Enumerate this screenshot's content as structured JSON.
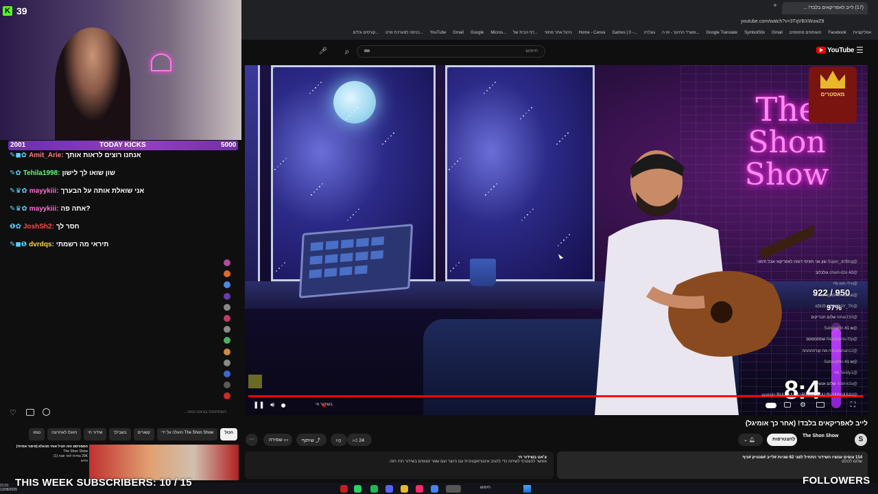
{
  "browser": {
    "tab_title": "(17) לייב לאפריקאים בלבד! ...",
    "url": "youtube.com/watch?v=3TqVBXWuwZ8",
    "bookmarks": [
      "אפליקציות",
      "Facebook",
      "השותפים מתמסים",
      "Gmail",
      "SymbolStix",
      "Google Translate",
      "משרד החינוך - זוז ה...",
      "גוגלרה",
      "Games | 0 -...",
      "Home - Canva",
      "ניהול אתר מחוזי",
      "דף הבית של...",
      "Micros...",
      "Google",
      "Gmail",
      "YouTube",
      "כניסה למערכת פרט...",
      "קורסים וכלים..."
    ]
  },
  "youtube": {
    "search_placeholder": "חיפוש",
    "logo_text": "YouTube",
    "video_title": "לייב לאפריקאים בלבד! (אחר כך אומיגל)",
    "channel_name": "The Shon Show",
    "subscribe_label": "להצטרפות",
    "like_count": "24",
    "share_label": "שיתוף",
    "save_label": "שמירה",
    "live_label": "בשידור חי",
    "description_meta": "114 צופים עכשיו  השידור התחיל לפני 62 שניות  #לייב #פנטיק #כיף",
    "description_text": "שלום לכולם",
    "chat_summary": "צ'אט בשידור חי",
    "chat_summary_sub": "אפשר להצטרף לשיחה כדי להגיב אינטראקטיבית עם היוצר ועם שאר הצופים בשידור החי הזה."
  },
  "video_overlay": {
    "neon_line1": "The",
    "neon_line2": "Shon Show",
    "badge_text": "מאסטרים",
    "timer": "8:4",
    "goal_text": "922 / 950",
    "goal_percent_label": "97%",
    "goal_fraction": 0.97
  },
  "stream_overlay": {
    "kick_count": "39",
    "kicks_min": "2001",
    "kicks_label": "TODAY KICKS",
    "kicks_max": "5000",
    "subs_text": "THIS WEEK SUBSCRIBERS: 10 / 15",
    "followers_text": "FOLLOWERS"
  },
  "kick_chat": [
    {
      "user": "Amit_Arie:",
      "text": "אנחנו רוצים לראות אותך",
      "color": "#ff7b7b",
      "badges": "✎◼✿"
    },
    {
      "user": "Tehila1998:",
      "text": "שון שואו לך לישון",
      "color": "#5cff7a",
      "badges": "✎✿"
    },
    {
      "user": "mayykiii:",
      "text": "אני שואלת אותה על הבערך",
      "color": "#ff6bd6",
      "badges": "✎♛✿"
    },
    {
      "user": "mayykiii:",
      "text": "אתה פה?",
      "color": "#ff6bd6",
      "badges": "✎♛✿"
    },
    {
      "user": "JoshSh2:",
      "text": "חסר לך",
      "color": "#ff4a4a",
      "badges": "❶✿"
    },
    {
      "user": "dvrdqs:",
      "text": "תיראי מה רשמתי",
      "color": "#ffd84a",
      "badges": "✎◼❶"
    }
  ],
  "yt_chat": [
    {
      "user": "@Super_drifting",
      "text": "שון אני תפיסי דומה לאפריקאי אבל תימני",
      "avatar": "#b04a9a"
    },
    {
      "user": "@charil-d2e",
      "text": "#2 גולבלוב",
      "avatar": "#e06a2a"
    },
    {
      "user": "@ווילי-תאו",
      "text": "היי",
      "avatar": "#4a8ae0"
    },
    {
      "user": "@ВалерийПенкасов",
      "text": "היי",
      "avatar": "#6a3ab0"
    },
    {
      "user": "@ILAY_TK",
      "text": "שלום לכולם",
      "avatar": "#888888"
    },
    {
      "user": "@tohar150",
      "text": "שלום חבריקים",
      "avatar": "#c03a6a"
    },
    {
      "user": "@Sahargitlin",
      "text": "#1 w",
      "avatar": "#8a8a8a"
    },
    {
      "user": "@NextGame-f3p",
      "text": "שסססססם",
      "avatar": "#4ab06a"
    },
    {
      "user": "@mikadahan12",
      "text": "מה קורההההה",
      "avatar": "#d08a3a"
    },
    {
      "user": "@Sahargitlin",
      "text": "#1 w",
      "avatar": "#8a8a8a"
    },
    {
      "user": "@Tendy1",
      "text": "היי",
      "avatar": "#3a6ad0"
    },
    {
      "user": "@Adel-k3u",
      "text": "שלום אנשים",
      "avatar": "#5a5a5a"
    },
    {
      "user": "@ayalajin",
      "text": "RUUUUUUU RUUUUUUU RUUUUUUUU",
      "avatar": "#d02a2a"
    }
  ],
  "chat_input_placeholder": "השתתפות בצ'אט כמוני...",
  "chips": [
    "הכול",
    "הועלה על ידי The Shon Show",
    "קשורים",
    "בשבילך",
    "שידור חי",
    "הועלו לאחרונה",
    "נצפו"
  ],
  "recommended": {
    "title": "המפורסם הזה הציל אותי מהגלא (סיפור אמיתי)",
    "channel": "The Shon Show",
    "meta": "29K צפיות לפני שנה (1)",
    "duration": "חדש"
  },
  "taskbar": {
    "time": "21:01",
    "date": "13/08/2025",
    "search_label": "חיפוש"
  }
}
